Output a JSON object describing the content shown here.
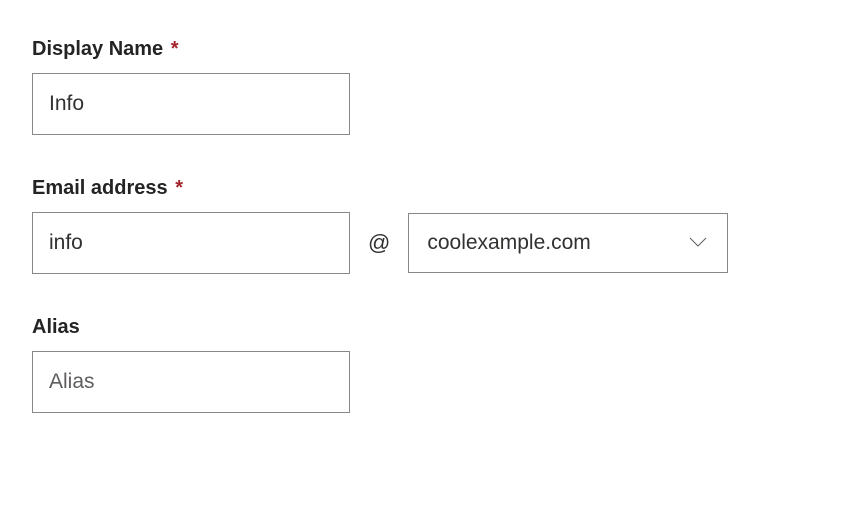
{
  "form": {
    "displayName": {
      "label": "Display Name",
      "required": true,
      "value": "Info"
    },
    "emailAddress": {
      "label": "Email address",
      "required": true,
      "value": "info",
      "atSymbol": "@",
      "domain": "coolexample.com"
    },
    "alias": {
      "label": "Alias",
      "required": false,
      "value": "",
      "placeholder": "Alias"
    }
  }
}
